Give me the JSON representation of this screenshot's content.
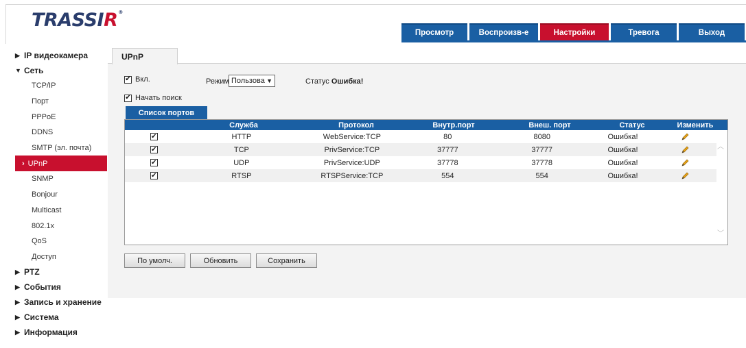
{
  "brand": {
    "logo_main": "TRASSI",
    "logo_r": "R",
    "logo_reg": "®"
  },
  "topnav": [
    {
      "label": "Просмотр",
      "active": false
    },
    {
      "label": "Воспроизв-е",
      "active": false
    },
    {
      "label": "Настройки",
      "active": true
    },
    {
      "label": "Тревога",
      "active": false
    },
    {
      "label": "Выход",
      "active": false
    }
  ],
  "sidebar": {
    "ip_camera": "IP видеокамера",
    "network": "Сеть",
    "network_items": [
      "TCP/IP",
      "Порт",
      "PPPoE",
      "DDNS",
      "SMTP (эл. почта)",
      "UPnP",
      "SNMP",
      "Bonjour",
      "Multicast",
      "802.1x",
      "QoS",
      "Доступ"
    ],
    "active_item": "UPnP",
    "ptz": "PTZ",
    "events": "События",
    "recording": "Запись и хранение",
    "system": "Система",
    "info": "Информация"
  },
  "page": {
    "tab": "UPnP",
    "enable_label": "Вкл.",
    "enable_checked": true,
    "mode_label": "Режим",
    "mode_value": "Пользова",
    "status_label": "Статус",
    "status_value": "Ошибка!",
    "search_label": "Начать поиск",
    "search_checked": true,
    "ports_tab": "Список портов"
  },
  "table": {
    "headers": [
      "",
      "Служба",
      "Протокол",
      "Внутр.порт",
      "Внеш. порт",
      "Статус",
      "Изменить"
    ],
    "rows": [
      {
        "checked": true,
        "service": "HTTP",
        "protocol": "WebService:TCP",
        "internal": "80",
        "external": "8080",
        "status": "Ошибка!"
      },
      {
        "checked": true,
        "service": "TCP",
        "protocol": "PrivService:TCP",
        "internal": "37777",
        "external": "37777",
        "status": "Ошибка!"
      },
      {
        "checked": true,
        "service": "UDP",
        "protocol": "PrivService:UDP",
        "internal": "37778",
        "external": "37778",
        "status": "Ошибка!"
      },
      {
        "checked": true,
        "service": "RTSP",
        "protocol": "RTSPService:TCP",
        "internal": "554",
        "external": "554",
        "status": "Ошибка!"
      }
    ]
  },
  "buttons": {
    "default": "По умолч.",
    "refresh": "Обновить",
    "save": "Сохранить"
  },
  "colors": {
    "brand_blue": "#1a5fa3",
    "brand_red": "#c8102e"
  },
  "icons": {
    "edit": "pencil-icon",
    "check": "checkmark-icon"
  }
}
